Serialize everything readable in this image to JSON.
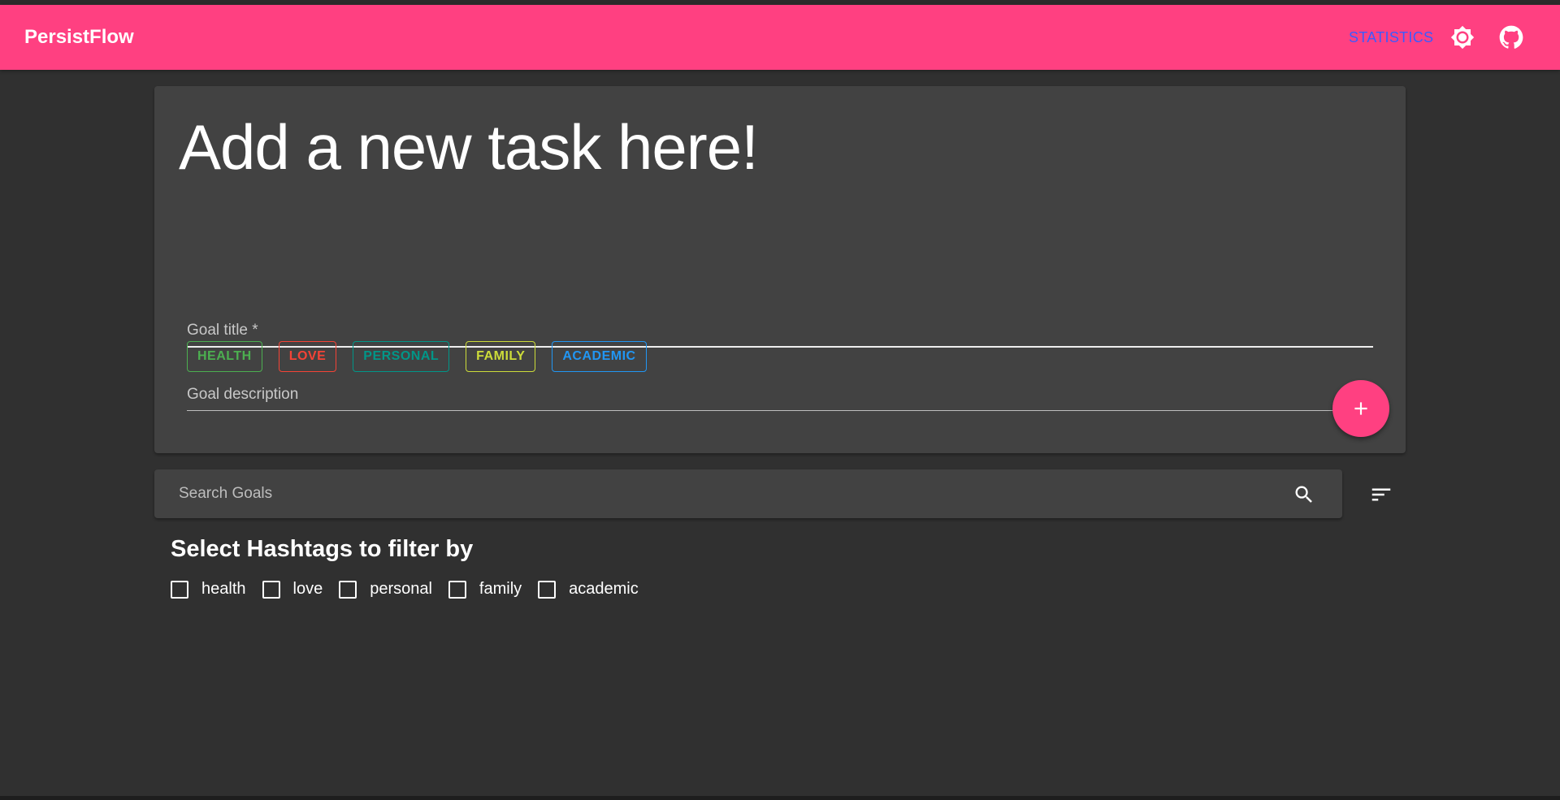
{
  "appbar": {
    "brand": "PersistFlow",
    "statistics_link": "STATISTICS",
    "theme_icon": "brightness-icon",
    "github_icon": "github-icon",
    "color": "#ff4081"
  },
  "card": {
    "title": "Add a new task here!",
    "goal_title_label": "Goal title *",
    "goal_description_label": "Goal description",
    "tags": [
      {
        "label": "HEALTH",
        "color": "#4caf50"
      },
      {
        "label": "LOVE",
        "color": "#f44336"
      },
      {
        "label": "PERSONAL",
        "color": "#009688"
      },
      {
        "label": "FAMILY",
        "color": "#cddc39"
      },
      {
        "label": "ACADEMIC",
        "color": "#2196f3"
      }
    ],
    "add_icon": "plus-icon"
  },
  "search": {
    "placeholder": "Search Goals",
    "search_icon": "search-icon",
    "sort_icon": "sort-icon"
  },
  "filter": {
    "title": "Select Hashtags to filter by",
    "hashtags": [
      {
        "label": "health",
        "checked": false
      },
      {
        "label": "love",
        "checked": false
      },
      {
        "label": "personal",
        "checked": false
      },
      {
        "label": "family",
        "checked": false
      },
      {
        "label": "academic",
        "checked": false
      }
    ]
  }
}
